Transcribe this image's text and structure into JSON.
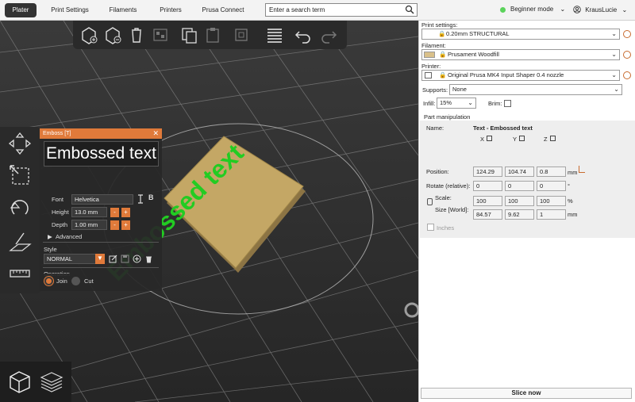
{
  "topbar": {
    "tabs": [
      {
        "label": "Plater",
        "active": true
      },
      {
        "label": "Print Settings",
        "active": false
      },
      {
        "label": "Filaments",
        "active": false
      },
      {
        "label": "Printers",
        "active": false
      },
      {
        "label": "Prusa Connect",
        "active": false
      }
    ],
    "search_placeholder": "Enter a search term",
    "mode_label": "Beginner mode",
    "mode_color": "#5bd35b",
    "user_label": "KrausLucie"
  },
  "scene": {
    "model_text": "Embossed text",
    "text_color": "#22cc22",
    "plate_color": "#c4a765"
  },
  "emboss": {
    "title": "Emboss [T]",
    "text": "Embossed text",
    "font_label": "Font",
    "font_value": "Helvetica",
    "height_label": "Height",
    "height_value": "13.0 mm",
    "depth_label": "Depth",
    "depth_value": "1.00 mm",
    "advanced_label": "Advanced",
    "style_label": "Style",
    "style_value": "NORMAL",
    "operation_label": "Operation",
    "join_label": "Join",
    "cut_label": "Cut",
    "accent": "#e07a3a"
  },
  "sidebar": {
    "print_settings_label": "Print settings:",
    "print_settings_value": "0.20mm STRUCTURAL",
    "filament_label": "Filament:",
    "filament_value": "Prusament Woodfill",
    "filament_color": "#d9c08a",
    "printer_label": "Printer:",
    "printer_value": "Original Prusa MK4 Input Shaper 0.4 nozzle",
    "supports_label": "Supports:",
    "supports_value": "None",
    "infill_label": "Infill:",
    "infill_value": "15%",
    "brim_label": "Brim:",
    "part_manipulation_label": "Part manipulation",
    "name_label": "Name:",
    "name_value": "Text - Embossed text",
    "axis_x": "X",
    "axis_y": "Y",
    "axis_z": "Z",
    "position_label": "Position:",
    "position": [
      "124.29",
      "104.74",
      "0.8"
    ],
    "rotate_label": "Rotate (relative):",
    "rotate": [
      "0",
      "0",
      "0"
    ],
    "rotate_unit": "°",
    "scale_label": "Scale:",
    "scale": [
      "100",
      "100",
      "100"
    ],
    "scale_unit": "%",
    "size_label": "Size [World]:",
    "size": [
      "84.57",
      "9.62",
      "1"
    ],
    "unit_mm": "mm",
    "inches_label": "Inches",
    "slice_label": "Slice now"
  }
}
